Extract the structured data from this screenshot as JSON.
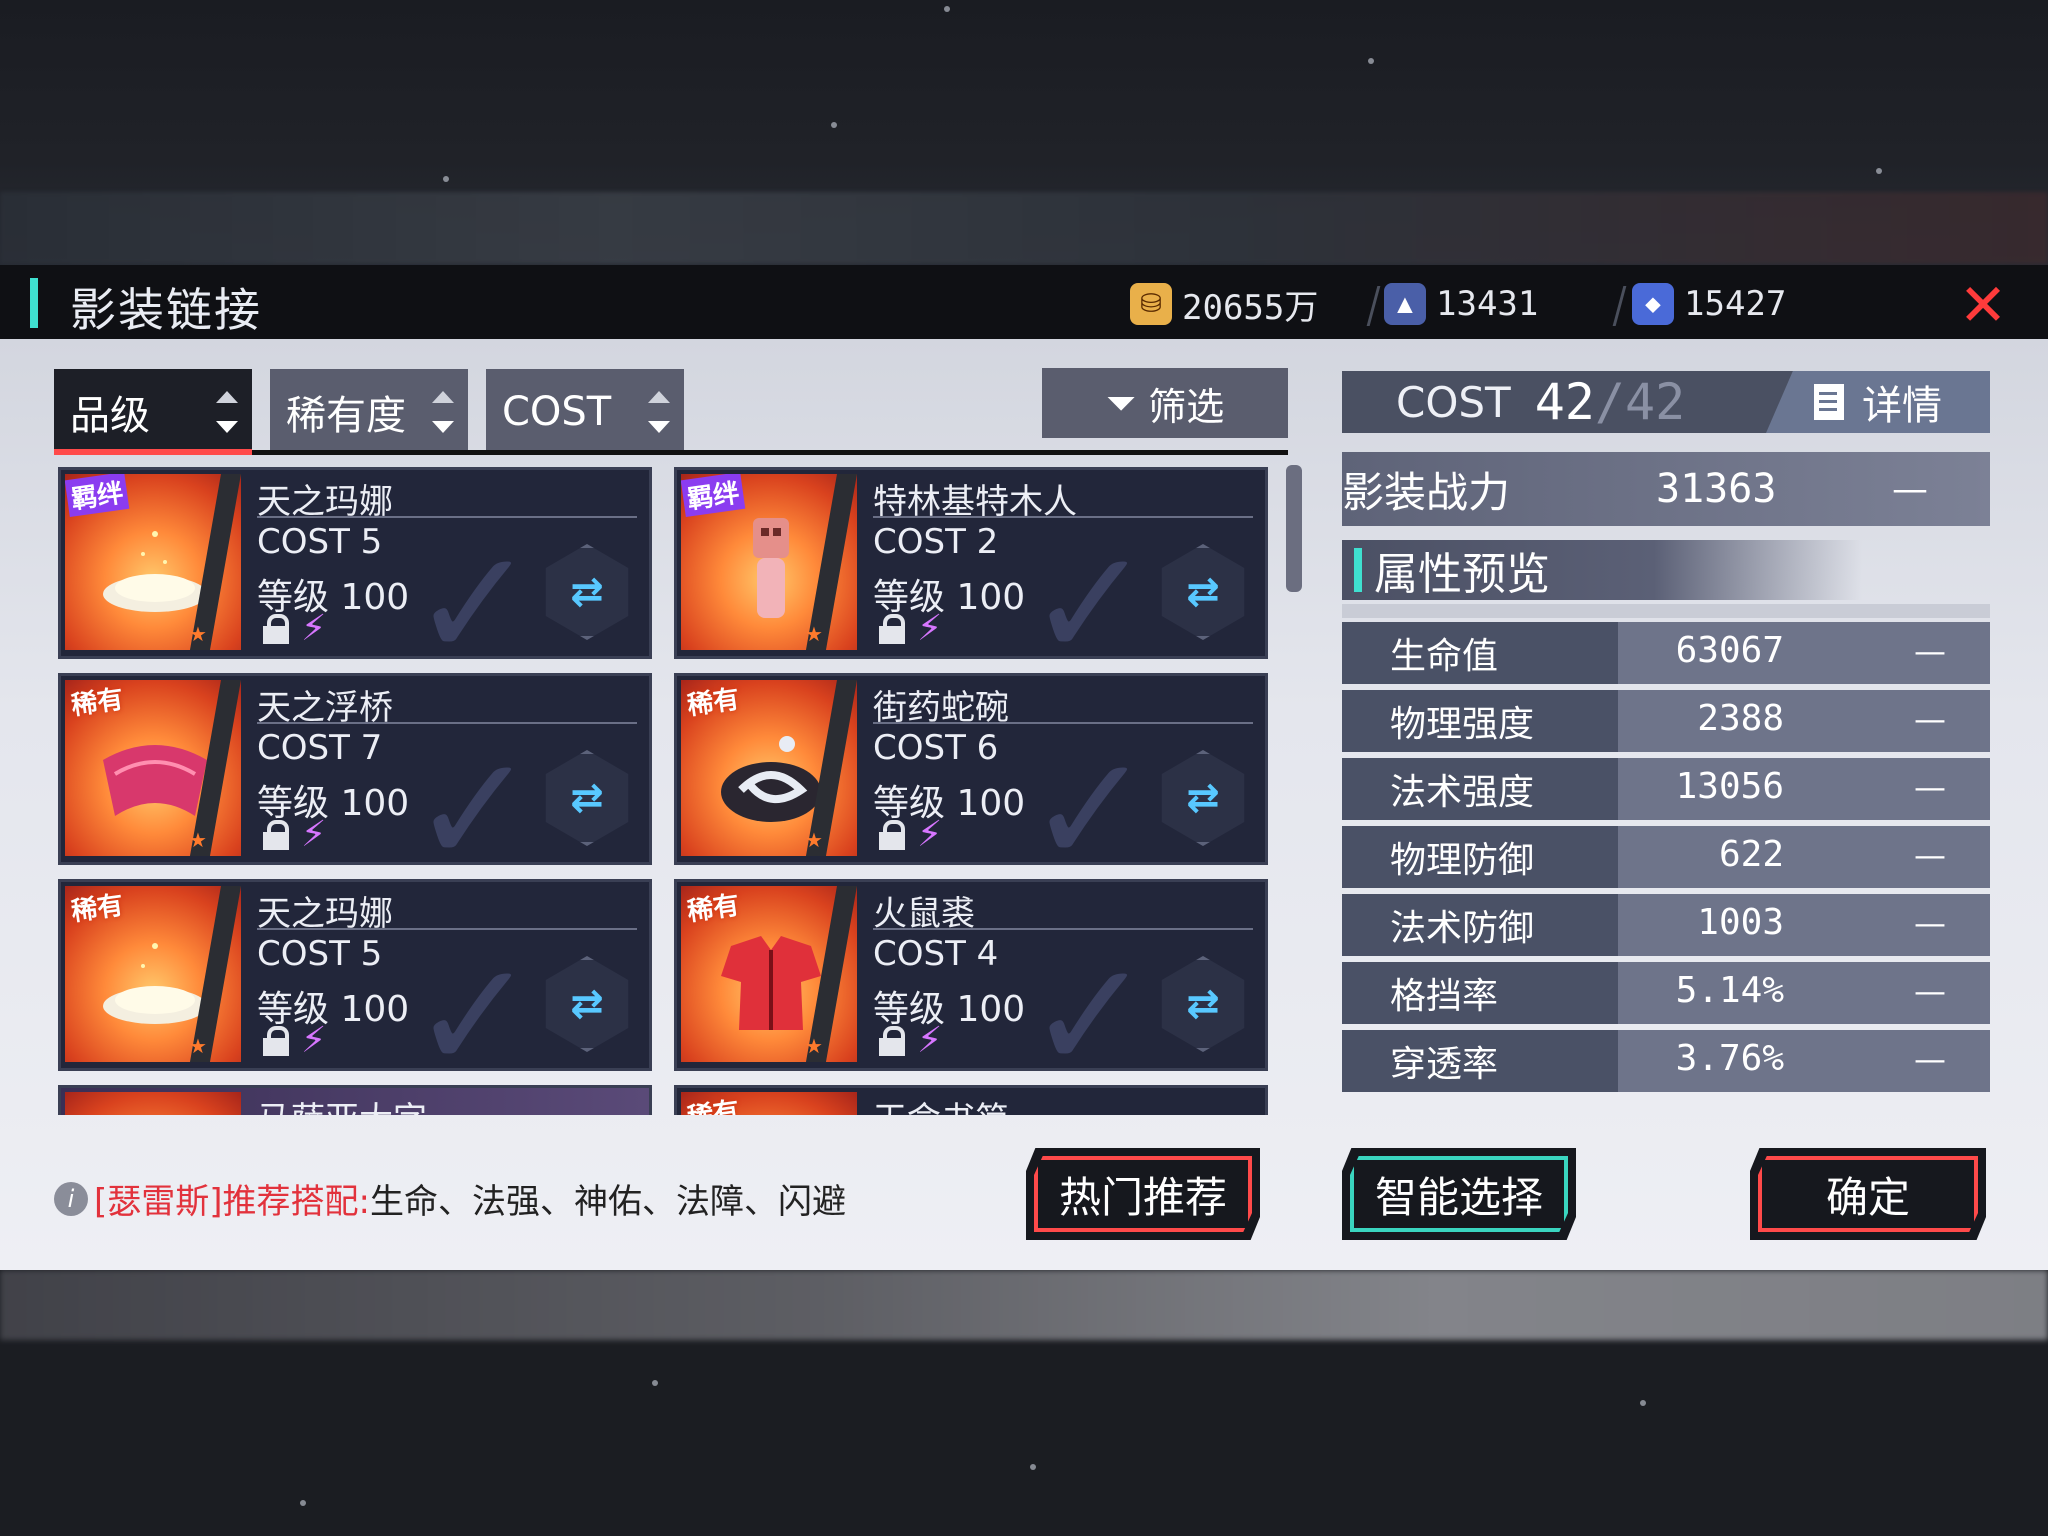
{
  "header": {
    "title": "影装链接",
    "currencies": [
      {
        "icon": "gold-coin-icon",
        "value": "20655万"
      },
      {
        "icon": "crystal-shard-icon",
        "value": "13431"
      },
      {
        "icon": "diamond-icon",
        "value": "15427"
      }
    ]
  },
  "sort_tabs": [
    {
      "label": "品级",
      "active": true
    },
    {
      "label": "稀有度",
      "active": false
    },
    {
      "label": "COST",
      "active": false
    }
  ],
  "filter": {
    "label": "筛选"
  },
  "items": [
    {
      "badge": "羁绊",
      "name": "天之玛娜",
      "cost": "COST 5",
      "level": "等级 100"
    },
    {
      "badge": "羁绊",
      "name": "特林基特木人",
      "cost": "COST 2",
      "level": "等级 100"
    },
    {
      "badge": "稀有",
      "name": "天之浮桥",
      "cost": "COST 7",
      "level": "等级 100"
    },
    {
      "badge": "稀有",
      "name": "街药蛇碗",
      "cost": "COST 6",
      "level": "等级 100"
    },
    {
      "badge": "稀有",
      "name": "天之玛娜",
      "cost": "COST 5",
      "level": "等级 100"
    },
    {
      "badge": "稀有",
      "name": "火鼠裘",
      "cost": "COST 4",
      "level": "等级 100"
    },
    {
      "badge": "",
      "name": "马萨亚大字",
      "cost": "",
      "level": ""
    },
    {
      "badge": "稀有",
      "name": "天命书简",
      "cost": "",
      "level": ""
    }
  ],
  "hint": {
    "hero": "[瑟雷斯]推荐搭配:",
    "attrs": "生命、法强、神佑、法障、闪避"
  },
  "buttons": {
    "popular": "热门推荐",
    "smart": "智能选择",
    "confirm": "确定"
  },
  "right_panel": {
    "cost_label": "COST",
    "cost_current": "42",
    "cost_max": "/42",
    "detail": "详情",
    "power_label": "影装战力",
    "power_value": "31363",
    "power_delta": "—",
    "section_title": "属性预览",
    "stats": [
      {
        "name": "生命值",
        "value": "63067",
        "delta": "—"
      },
      {
        "name": "物理强度",
        "value": "2388",
        "delta": "—"
      },
      {
        "name": "法术强度",
        "value": "13056",
        "delta": "—"
      },
      {
        "name": "物理防御",
        "value": "622",
        "delta": "—"
      },
      {
        "name": "法术防御",
        "value": "1003",
        "delta": "—"
      },
      {
        "name": "格挡率",
        "value": "5.14%",
        "delta": "—"
      },
      {
        "name": "穿透率",
        "value": "3.76%",
        "delta": "—"
      }
    ]
  },
  "colors": {
    "accent_teal": "#3fe0d0",
    "accent_red": "#ff4a4a",
    "bolt_purple": "#d776ff"
  }
}
